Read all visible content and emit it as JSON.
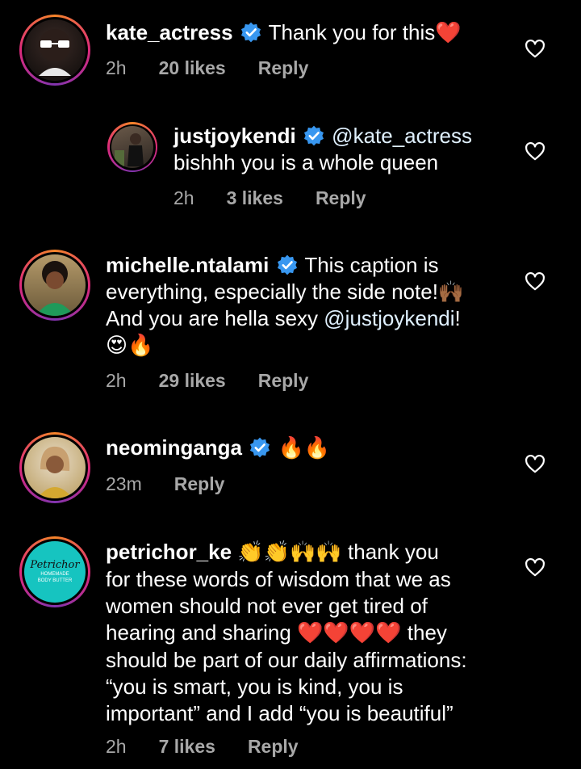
{
  "comments": [
    {
      "username": "kate_actress",
      "text": "Thank you for this",
      "emoji_tail": "❤️",
      "time": "2h",
      "likes": "20 likes",
      "reply": "Reply"
    },
    {
      "username": "justjoykendi",
      "mention": "@kate_actress",
      "text": "bishhh you is a whole queen",
      "time": "2h",
      "likes": "3 likes",
      "reply": "Reply"
    },
    {
      "username": "michelle.ntalami",
      "line1": "This caption is",
      "line2": "everything, especially the side note!🙌🏾",
      "line3_pre": "And you are hella sexy ",
      "line3_mention": "@justjoykendi",
      "line3_post": "!",
      "line4": "😍🔥",
      "time": "2h",
      "likes": "29 likes",
      "reply": "Reply"
    },
    {
      "username": "neominganga",
      "text": "🔥🔥",
      "time": "23m",
      "reply": "Reply"
    },
    {
      "username": "petrichor_ke",
      "line1_emoji": "👏👏🙌🙌",
      "line1_text": " thank you",
      "line2": "for these words of wisdom that we as",
      "line3": "women should not ever get tired of",
      "line4_pre": "hearing and sharing ",
      "line4_emoji": "❤️❤️❤️❤️",
      "line4_post": " they",
      "line5": "should be part of our daily affirmations:",
      "line6": "“you is smart, you is kind, you is",
      "line7": "important” and I add “you is beautiful”",
      "time": "2h",
      "likes": "7 likes",
      "reply": "Reply",
      "avatar_text": "Petrichor",
      "avatar_sub1": "HOMEMADE",
      "avatar_sub2": "BODY BUTTER"
    }
  ],
  "colors": {
    "verified": "#3897f0",
    "meta": "#a8a8a8",
    "background": "#000000"
  }
}
